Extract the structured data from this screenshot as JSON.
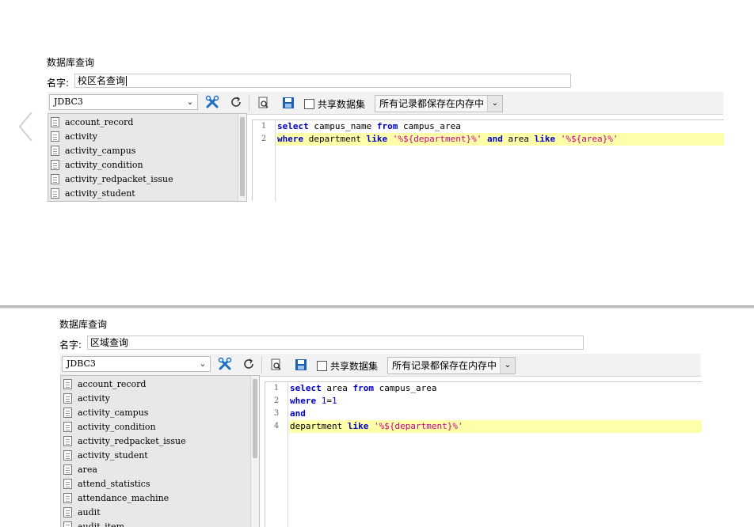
{
  "colors": {
    "keyword": "#0000c8",
    "string": "#c8008c",
    "highlight": "#ffffaa",
    "tree_bg": "#e8e8e8"
  },
  "dialogs": [
    {
      "title": "数据库查询",
      "name_label": "名字:",
      "name_value": "校区名查询",
      "datasource": "JDBC3",
      "share_label": "共享数据集",
      "memory_option": "所有记录都保存在内存中",
      "tables": [
        "account_record",
        "activity",
        "activity_campus",
        "activity_condition",
        "activity_redpacket_issue",
        "activity_student"
      ],
      "line_numbers": [
        "1",
        "2"
      ],
      "sql": [
        [
          {
            "t": "select",
            "c": "kw"
          },
          {
            "t": " campus_name ",
            "c": ""
          },
          {
            "t": "from",
            "c": "kw"
          },
          {
            "t": " campus_area",
            "c": ""
          }
        ],
        [
          {
            "t": "where",
            "c": "kw"
          },
          {
            "t": " department ",
            "c": ""
          },
          {
            "t": "like",
            "c": "kw"
          },
          {
            "t": " ",
            "c": ""
          },
          {
            "t": "'%${department}%'",
            "c": "str"
          },
          {
            "t": " ",
            "c": ""
          },
          {
            "t": "and",
            "c": "kw"
          },
          {
            "t": " area ",
            "c": ""
          },
          {
            "t": "like",
            "c": "kw"
          },
          {
            "t": " ",
            "c": ""
          },
          {
            "t": "'%${area}%'",
            "c": "str"
          }
        ]
      ],
      "highlight_line": 1
    },
    {
      "title": "数据库查询",
      "name_label": "名字:",
      "name_value": "区域查询",
      "datasource": "JDBC3",
      "share_label": "共享数据集",
      "memory_option": "所有记录都保存在内存中",
      "tables": [
        "account_record",
        "activity",
        "activity_campus",
        "activity_condition",
        "activity_redpacket_issue",
        "activity_student",
        "area",
        "attend_statistics",
        "attendance_machine",
        "audit",
        "audit_item"
      ],
      "line_numbers": [
        "1",
        "2",
        "3",
        "4"
      ],
      "sql": [
        [
          {
            "t": "select",
            "c": "kw"
          },
          {
            "t": " area ",
            "c": ""
          },
          {
            "t": "from",
            "c": "kw"
          },
          {
            "t": " campus_area",
            "c": ""
          }
        ],
        [
          {
            "t": "where",
            "c": "kw"
          },
          {
            "t": " ",
            "c": ""
          },
          {
            "t": "1",
            "c": "num"
          },
          {
            "t": "=",
            "c": ""
          },
          {
            "t": "1",
            "c": "num"
          }
        ],
        [
          {
            "t": "and",
            "c": "kw"
          }
        ],
        [
          {
            "t": "department ",
            "c": ""
          },
          {
            "t": "like",
            "c": "kw"
          },
          {
            "t": " ",
            "c": ""
          },
          {
            "t": "'%${department}%'",
            "c": "str"
          }
        ]
      ],
      "highlight_line": 3
    }
  ]
}
